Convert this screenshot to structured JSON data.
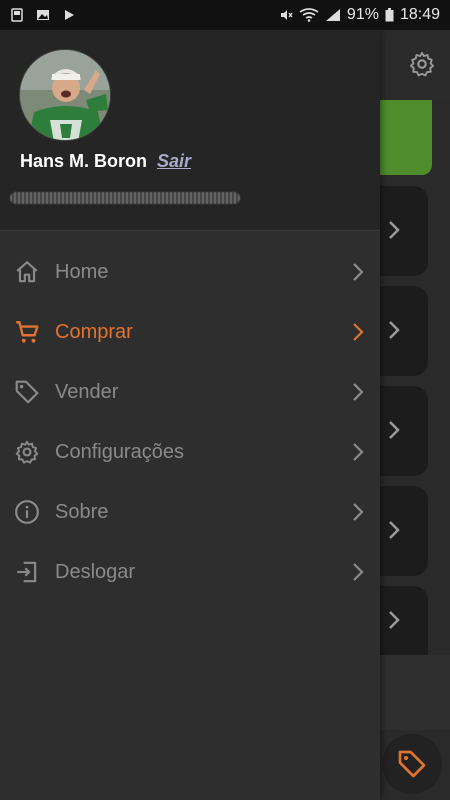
{
  "status_bar": {
    "battery": "91%",
    "time": "18:49"
  },
  "user": {
    "name": "Hans M. Boron",
    "logout_label": "Sair"
  },
  "menu": {
    "items": [
      {
        "label": "Home",
        "icon": "home-icon"
      },
      {
        "label": "Comprar",
        "icon": "cart-icon",
        "active": true
      },
      {
        "label": "Vender",
        "icon": "tag-icon"
      },
      {
        "label": "Configurações",
        "icon": "gear-icon"
      },
      {
        "label": "Sobre",
        "icon": "info-icon"
      },
      {
        "label": "Deslogar",
        "icon": "logout-icon"
      }
    ]
  },
  "colors": {
    "accent": "#e2732f",
    "menu_text": "#8a8a8a",
    "drawer_bg": "#2e2e2e",
    "header_bg": "#252525",
    "green_banner": "#4e8c2c"
  }
}
